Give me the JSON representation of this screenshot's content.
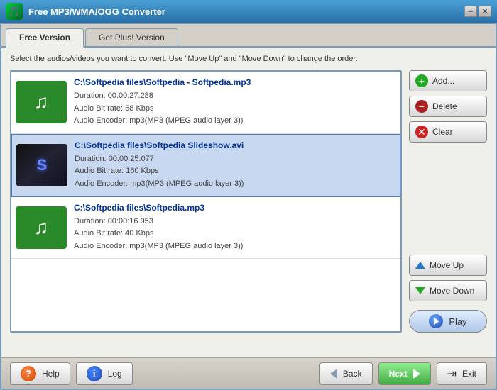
{
  "titleBar": {
    "title": "Free MP3/WMA/OGG Converter",
    "minBtn": "─",
    "closeBtn": "✕"
  },
  "tabs": [
    {
      "id": "free",
      "label": "Free Version",
      "active": true
    },
    {
      "id": "plus",
      "label": "Get Plus! Version",
      "active": false
    }
  ],
  "instruction": "Select the audios/videos you want to convert. Use \"Move Up\" and \"Move Down\" to change the order.",
  "files": [
    {
      "name": "C:\\Softpedia files\\Softpedia - Softpedia.mp3",
      "type": "audio",
      "duration": "Duration: 00:00:27.288",
      "bitrate": "Audio Bit rate: 58 Kbps",
      "encoder": "Audio Encoder: mp3(MP3 (MPEG audio layer 3))",
      "selected": false
    },
    {
      "name": "C:\\Softpedia files\\Softpedia Slideshow.avi",
      "type": "video",
      "duration": "Duration: 00:00:25.077",
      "bitrate": "Audio Bit rate: 160 Kbps",
      "encoder": "Audio Encoder: mp3(MP3 (MPEG audio layer 3))",
      "selected": true
    },
    {
      "name": "C:\\Softpedia files\\Softpedia.mp3",
      "type": "audio",
      "duration": "Duration: 00:00:16.953",
      "bitrate": "Audio Bit rate: 40 Kbps",
      "encoder": "Audio Encoder: mp3(MP3 (MPEG audio layer 3))",
      "selected": false
    }
  ],
  "buttons": {
    "add": "Add...",
    "delete": "Delete",
    "clear": "Clear",
    "moveUp": "Move Up",
    "moveDown": "Move Down",
    "play": "Play",
    "help": "Help",
    "log": "Log",
    "back": "Back",
    "next": "Next",
    "exit": "Exit"
  }
}
